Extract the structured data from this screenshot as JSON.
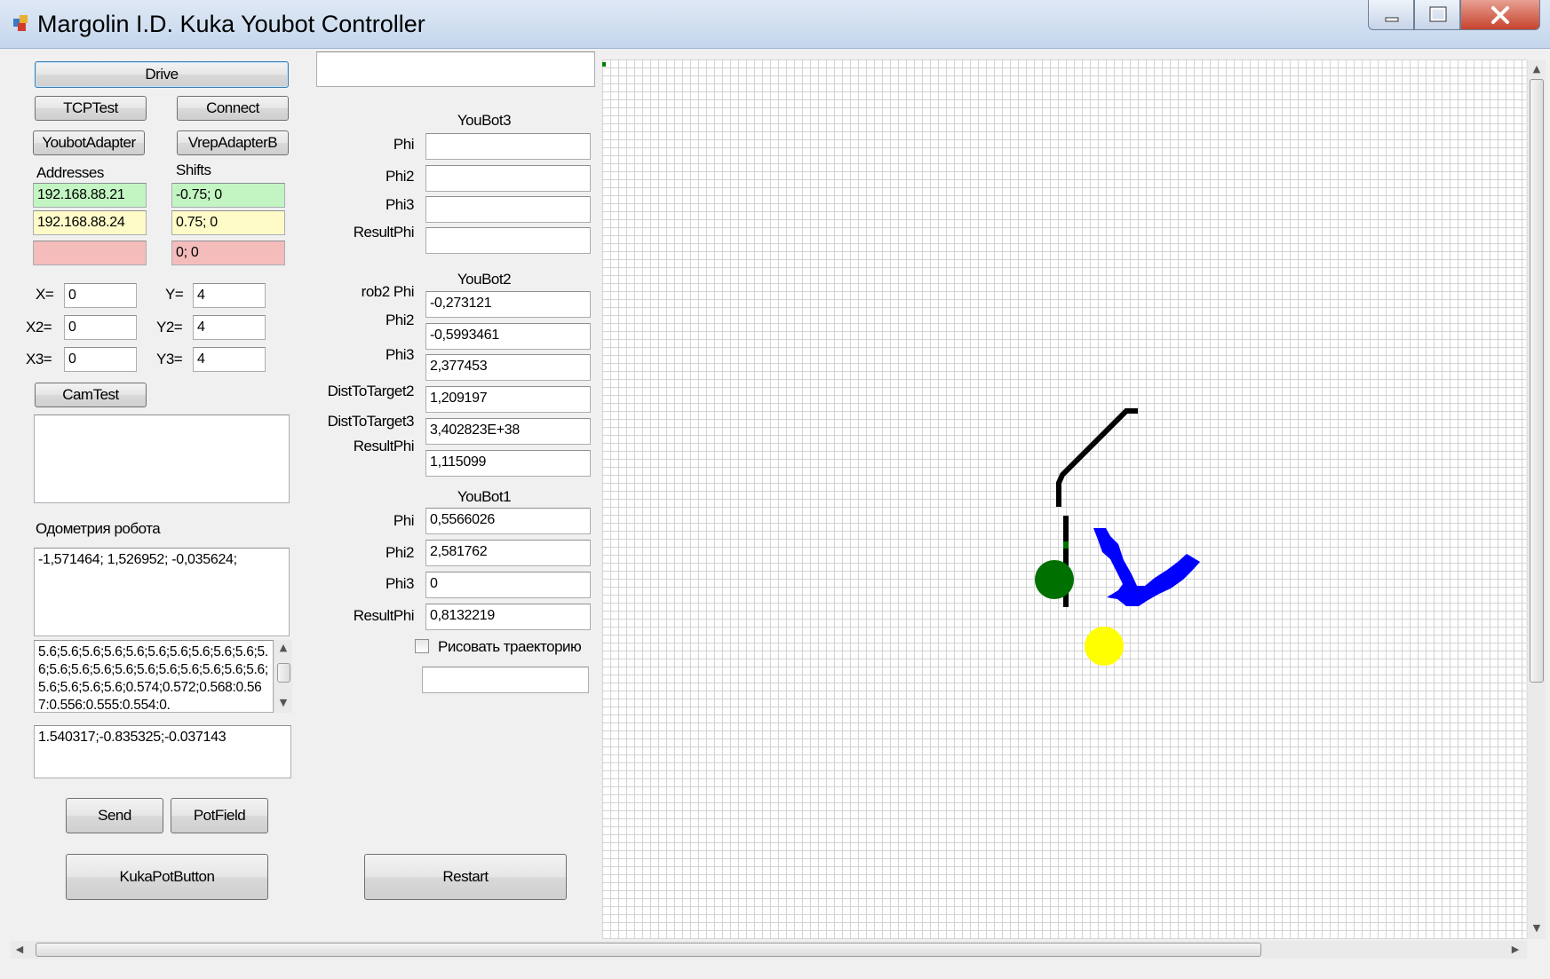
{
  "window": {
    "title": "Margolin I.D. Kuka Youbot Controller"
  },
  "buttons": {
    "drive": "Drive",
    "tcp_test": "TCPTest",
    "connect": "Connect",
    "youbot_adapter": "YoubotAdapter",
    "vrep_adapter": "VrepAdapterB",
    "cam_test": "CamTest",
    "send": "Send",
    "pot_field": "PotField",
    "kuka_pot_button": "KukaPotButton",
    "restart": "Restart"
  },
  "network": {
    "addresses_label": "Addresses",
    "shifts_label": "Shifts",
    "rows": [
      {
        "address": "192.168.88.21",
        "shift": "-0.75; 0",
        "color": "#c2f5c2"
      },
      {
        "address": "192.168.88.24",
        "shift": "0.75; 0",
        "color": "#fffbc8"
      },
      {
        "address": "",
        "shift": "0; 0",
        "color": "#f5bcbc"
      }
    ]
  },
  "coords": {
    "x1_label": "X=",
    "x1": "0",
    "y1_label": "Y=",
    "y1": "4",
    "x2_label": "X2=",
    "x2": "0",
    "y2_label": "Y2=",
    "y2": "4",
    "x3_label": "X3=",
    "x3": "0",
    "y3_label": "Y3=",
    "y3": "4"
  },
  "cam_output": "",
  "odometry": {
    "label": "Одометрия робота",
    "value": "-1,571464; 1,526952; -0,035624;"
  },
  "sensor_log": "5.6;5.6;5.6;5.6;5.6;5.6;5.6;5.6;5.6;5.6;5.6;5.6;5.6;5.6;5.6;5.6;5.6;5.6;5.6;5.6;5.6;5.6;5.6;5.6;5.6;0.574;0.572;0.568:0.567:0.556:0.555:0.554:0.",
  "command_input": "1.540317;-0.835325;-0.037143",
  "top_input": "",
  "youbot3": {
    "title": "YouBot3",
    "phi_label": "Phi",
    "phi": "",
    "phi2_label": "Phi2",
    "phi2": "",
    "phi3_label": "Phi3",
    "phi3": "",
    "result_label": "ResultPhi",
    "result": ""
  },
  "youbot2": {
    "title": "YouBot2",
    "phi_label": "rob2 Phi",
    "phi": "-0,273121",
    "phi2_label": "Phi2",
    "phi2": "-0,5993461",
    "phi3_label": "Phi3",
    "phi3": "2,377453",
    "dist2_label": "DistToTarget2",
    "dist2": "1,209197",
    "dist3_label": "DistToTarget3",
    "dist3": "3,402823E+38",
    "result_label": "ResultPhi",
    "result": "1,115099"
  },
  "youbot1": {
    "title": "YouBot1",
    "phi_label": "Phi",
    "phi": "0,5566026",
    "phi2_label": "Phi2",
    "phi2": "2,581762",
    "phi3_label": "Phi3",
    "phi3": "0",
    "result_label": "ResultPhi",
    "result": "0,8132219"
  },
  "trajectory": {
    "label": "Рисовать траекторию",
    "checked": false,
    "field": ""
  },
  "map_colors": {
    "path": "#000000",
    "robot": "#007000",
    "target": "#ffff00",
    "obstacle": "#0000ff"
  },
  "icons": {
    "app": "app-window-icon",
    "minimize": "minimize-icon",
    "maximize": "maximize-icon",
    "close": "close-icon"
  }
}
